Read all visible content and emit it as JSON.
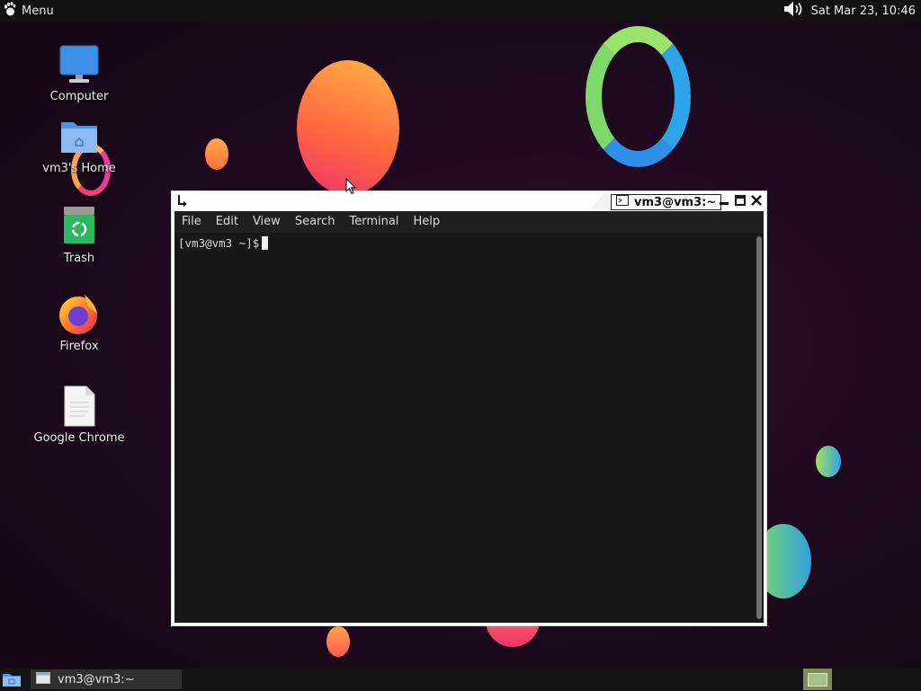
{
  "top_panel": {
    "menu_label": "Menu",
    "icons": {
      "menu": "gnome-foot-icon",
      "volume": "volume-icon"
    },
    "clock": "Sat Mar 23, 10:46"
  },
  "desktop": {
    "icons": [
      {
        "label": "Computer",
        "icon": "computer-icon"
      },
      {
        "label": "vm3's Home",
        "icon": "home-folder-icon"
      },
      {
        "label": "Trash",
        "icon": "trash-icon"
      },
      {
        "label": "Firefox",
        "icon": "firefox-icon"
      },
      {
        "label": "Google Chrome",
        "icon": "document-icon"
      }
    ]
  },
  "terminal": {
    "title": "vm3@vm3:~",
    "menu": [
      "File",
      "Edit",
      "View",
      "Search",
      "Terminal",
      "Help"
    ],
    "prompt": "[vm3@vm3 ~]$",
    "colors": {
      "background": "#171717",
      "text": "#d8d8d8"
    }
  },
  "taskbar": {
    "window_label": "vm3@vm3:~",
    "icons": {
      "show_desktop": "show-desktop-icon",
      "window": "terminal-window-icon",
      "workspace": "workspace-switcher-icon"
    }
  }
}
